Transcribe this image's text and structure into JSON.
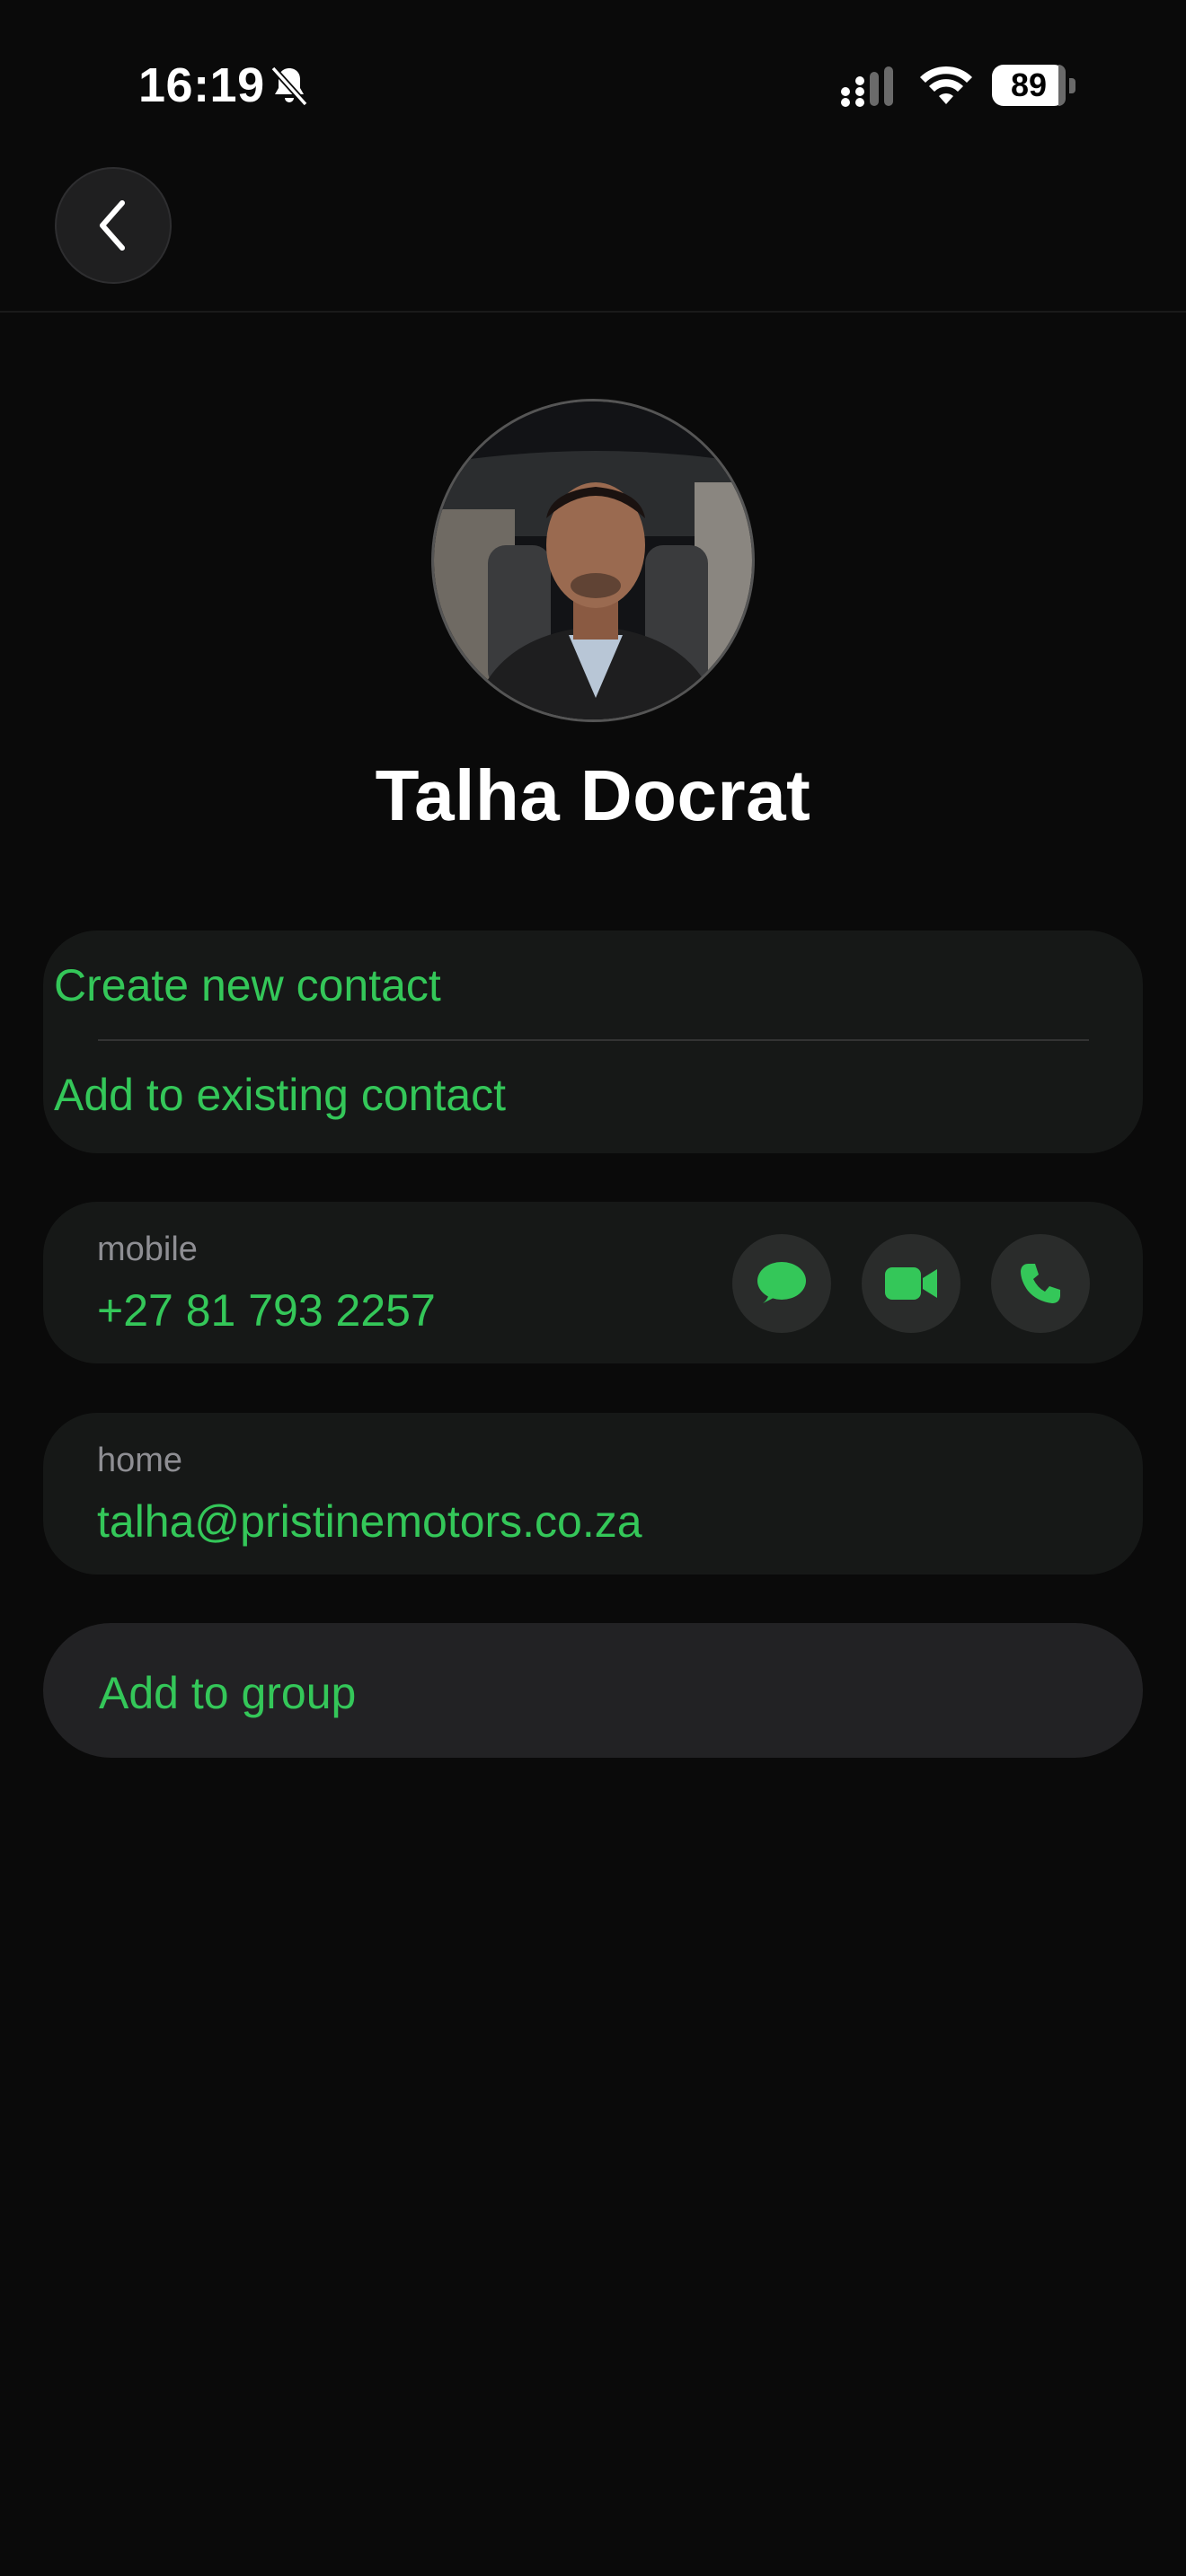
{
  "status_bar": {
    "time": "16:19",
    "battery": "89",
    "icons": [
      "bell-slash-icon",
      "cellular-signal-icon",
      "wifi-icon",
      "battery-icon"
    ]
  },
  "nav": {
    "back_icon": "chevron-left-icon"
  },
  "contact": {
    "name": "Talha Docrat"
  },
  "actions": {
    "create_new": "Create new contact",
    "add_existing": "Add to existing contact"
  },
  "phone": {
    "label": "mobile",
    "value": "+27 81 793 2257",
    "buttons": [
      "message-icon",
      "video-icon",
      "phone-icon"
    ]
  },
  "email": {
    "label": "home",
    "value": "talha@pristinemotors.co.za"
  },
  "group": {
    "label": "Add to group"
  },
  "colors": {
    "accent": "#34c759",
    "background": "#0a0a0a",
    "card": "#161817"
  }
}
